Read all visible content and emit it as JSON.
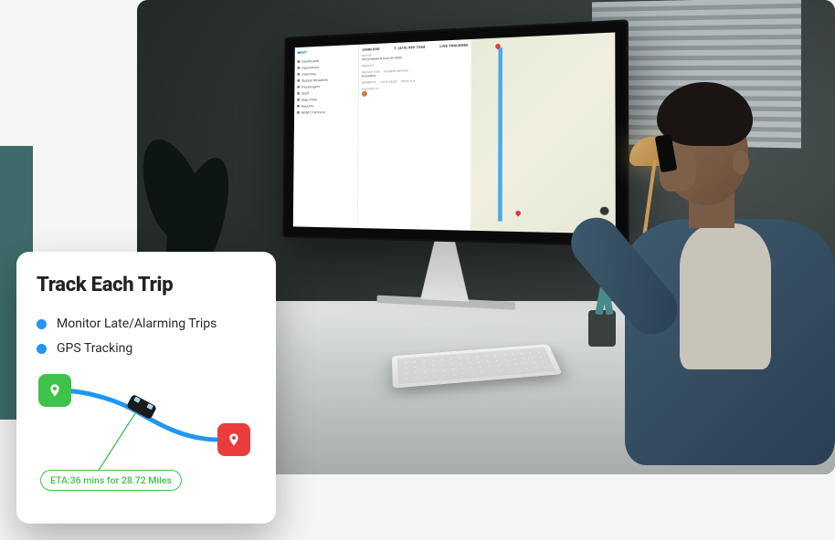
{
  "card": {
    "title": "Track Each Trip",
    "bullets": [
      "Monitor Late/Alarming Trips",
      "GPS Tracking"
    ],
    "eta": "ETA:36 mins for 28.72 Miles"
  },
  "screen": {
    "logo": {
      "n": "N",
      "emt": "EMT"
    },
    "sidebar": [
      "Dashboard",
      "Operations",
      "Alarming",
      "Signup Requests",
      "Passengers",
      "Staff",
      "Map View",
      "Reports",
      "NEMT Partners"
    ],
    "header": {
      "name": "JOHN DOE",
      "phone": "T: (419) 999-7244",
      "tab": "LIVE TRACKING"
    },
    "trip": {
      "pickup_label": "PICKUP",
      "pickup_addr": "220 W Market St Lima OH 45801",
      "dropoff_label": "DROPOFF",
      "service_label": "SERVICE TYPE",
      "service_value": "Ambulatory",
      "payment_label": "PAYMENT METHOD",
      "member_label": "MEMBER ID",
      "miles_label": "TOTAL MILES",
      "vehicle_label": "VEHICLE #",
      "assigned_label": "ASSIGNED TO:"
    }
  }
}
